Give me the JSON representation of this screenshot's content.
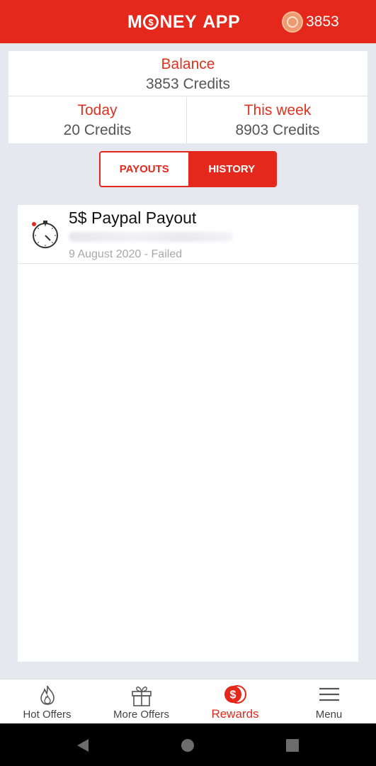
{
  "header": {
    "logo_before": "M",
    "logo_coin": "$",
    "logo_after": "NEY",
    "logo_app": "APP",
    "credits": "3853",
    "coin_icon": "coin-icon"
  },
  "stats": {
    "balance_label": "Balance",
    "balance_value": "3853 Credits",
    "today_label": "Today",
    "today_value": "20 Credits",
    "week_label": "This week",
    "week_value": "8903 Credits"
  },
  "tabs": {
    "payouts": "PAYOUTS",
    "history": "HISTORY",
    "active": "history"
  },
  "history": [
    {
      "icon": "stopwatch-icon",
      "title": "5$ Paypal Payout",
      "status": "9 August 2020 - Failed"
    }
  ],
  "bottom_nav": [
    {
      "label": "Hot Offers",
      "icon": "flame-icon",
      "active": false
    },
    {
      "label": "More Offers",
      "icon": "gift-icon",
      "active": false
    },
    {
      "label": "Rewards",
      "icon": "dollar-coin-icon",
      "active": true
    },
    {
      "label": "Menu",
      "icon": "hamburger-icon",
      "active": false
    }
  ],
  "system_nav": [
    "back-icon",
    "home-icon",
    "recents-icon"
  ],
  "colors": {
    "accent": "#e4281b",
    "background": "#e5e8ef",
    "muted_text": "#a8a8a8"
  }
}
